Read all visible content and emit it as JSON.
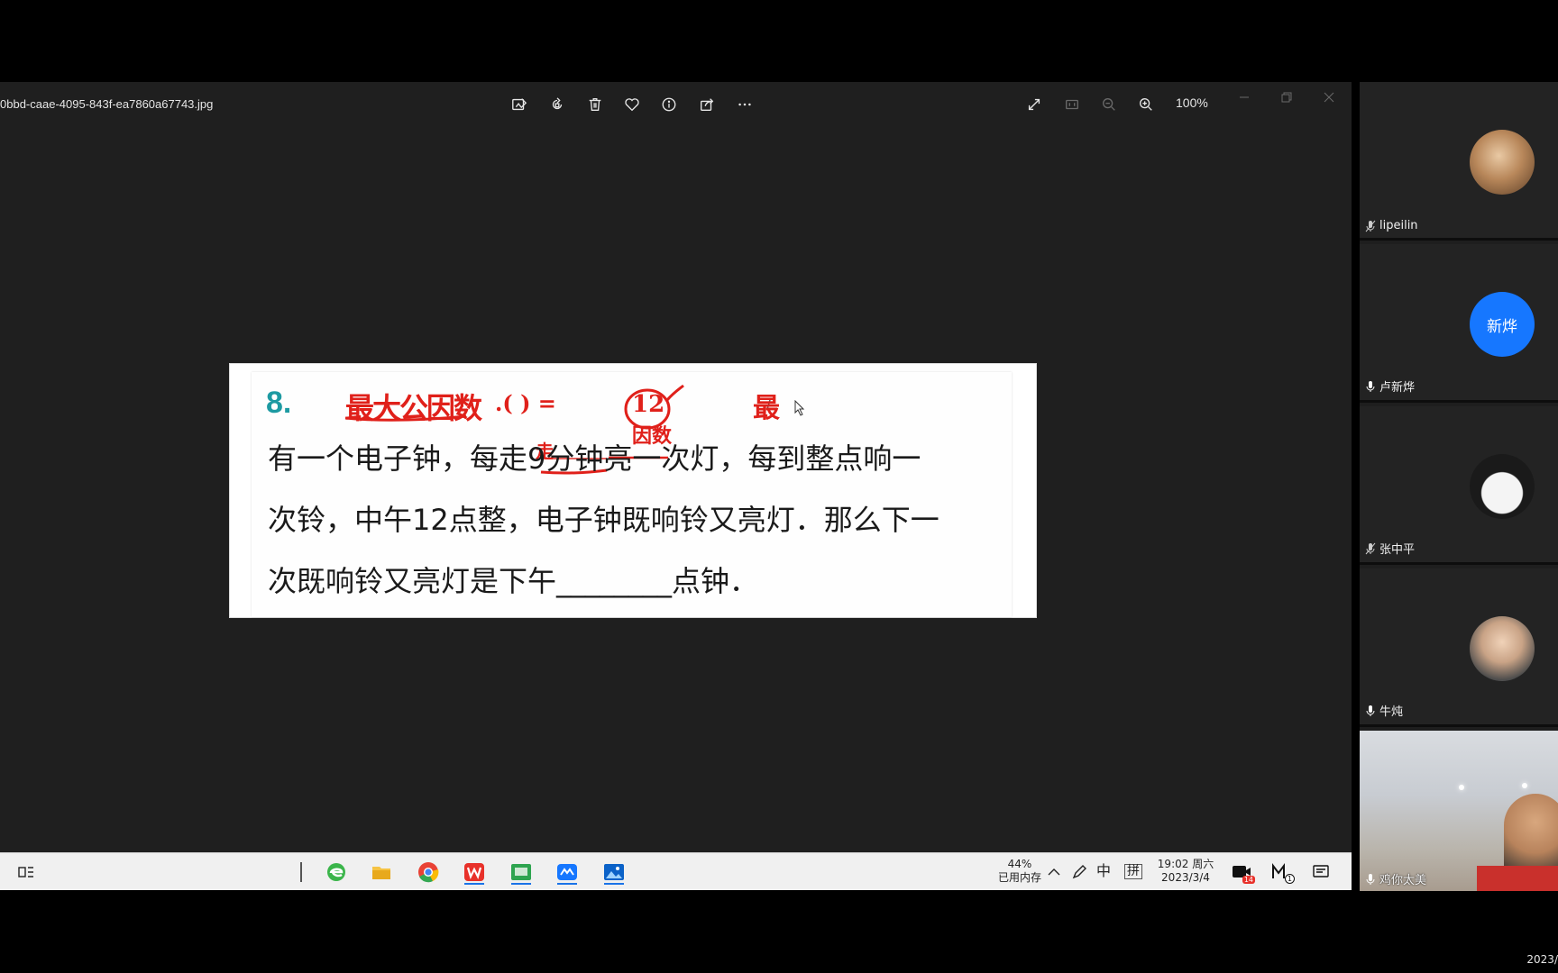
{
  "viewer": {
    "filename": "0bbd-caae-4095-843f-ea7860a67743.jpg",
    "zoom": "100%",
    "toolbar_icons": [
      "edit-image-icon",
      "rotate-icon",
      "delete-icon",
      "favorite-icon",
      "info-icon",
      "share-icon",
      "more-icon"
    ],
    "view_icons": [
      "fullscreen-icon",
      "fit-window-icon",
      "zoom-out-icon",
      "zoom-in-icon"
    ]
  },
  "photo": {
    "question_number": "8.",
    "lines": [
      "有一个电子钟，每走9分钟亮一次灯，每到整点响一",
      "次铃，中午12点整，电子钟既响铃又亮灯．那么下一",
      "次既响铃又亮灯是下午________点钟．"
    ],
    "handwriting": {
      "note_1": "最大公因数",
      "note_2": ".(   ) =",
      "note_3": "12",
      "note_4": "最",
      "note_5": "因数",
      "note_6": "走"
    }
  },
  "taskbar": {
    "memory_percent": "44%",
    "memory_label": "已用内存",
    "ime_lang": "中",
    "ime_mode": "拼",
    "time": "19:02 周六",
    "date": "2023/3/4",
    "mail_badge": "14",
    "m_badge": "1",
    "apps": [
      "task-view-icon",
      "edge-icon",
      "file-explorer-icon",
      "chrome-icon",
      "wps-icon",
      "app-icon",
      "meeting-icon",
      "photos-icon"
    ]
  },
  "participants": [
    {
      "name": "lipeilin",
      "avatar_text": ""
    },
    {
      "name": "卢新烨",
      "avatar_text": "新烨"
    },
    {
      "name": "张中平",
      "avatar_text": ""
    },
    {
      "name": "牛炖",
      "avatar_text": ""
    },
    {
      "name": "鸡你太美",
      "avatar_text": ""
    }
  ],
  "colors": {
    "accent_blue": "#1a73e8",
    "avatar_blue": "#1677ff",
    "handwriting_red": "#e0201a",
    "question_teal": "#1d9aa2"
  },
  "bottom_date": "2023/"
}
